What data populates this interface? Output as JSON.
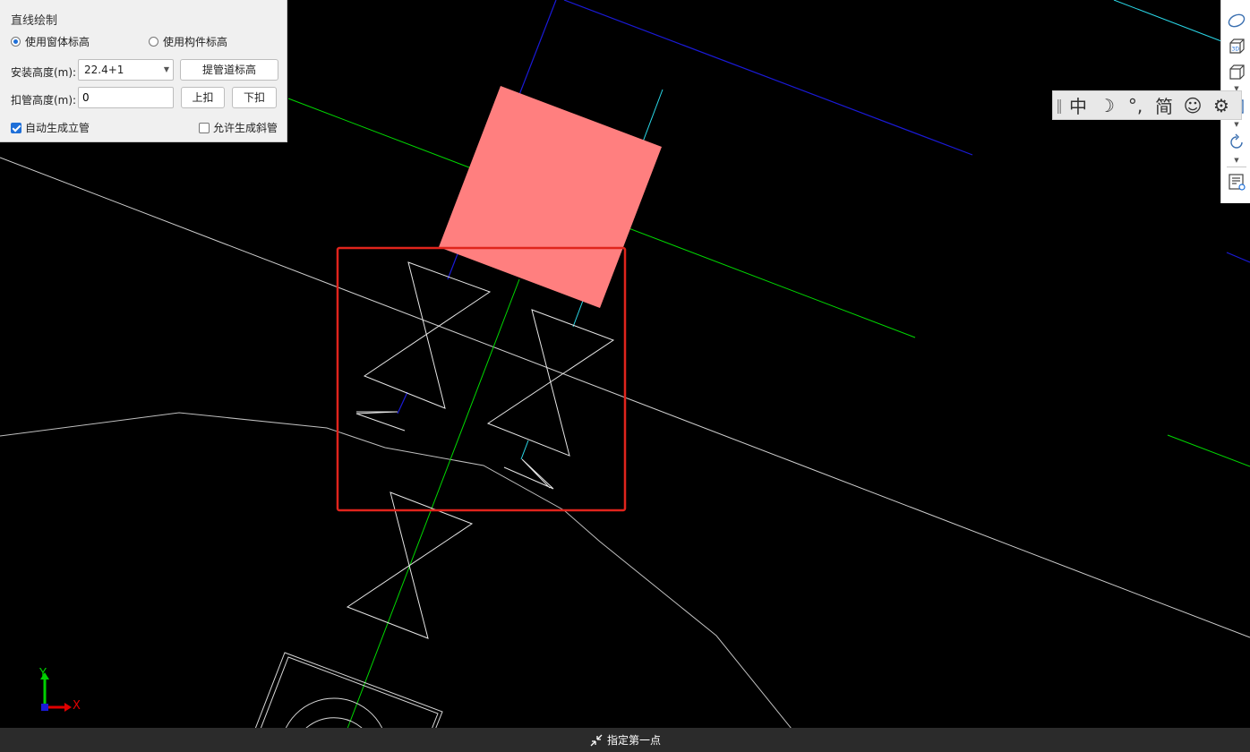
{
  "panel": {
    "title": "直线绘制",
    "radio_window": "使用窗体标高",
    "radio_component": "使用构件标高",
    "install_height_label": "安装高度(m):",
    "install_height_value": "22.4+1",
    "lift_pipe_button": "提管道标高",
    "buckle_height_label": "扣管高度(m):",
    "buckle_height_value": "0",
    "buckle_up_button": "上扣",
    "buckle_down_button": "下扣",
    "auto_riser_label": "自动生成立管",
    "auto_riser_checked": true,
    "allow_slant_label": "允许生成斜管",
    "allow_slant_checked": false
  },
  "ime": {
    "mode": "中",
    "night": "☽",
    "punct": "°,",
    "simplified": "简",
    "emoji": "☺",
    "settings": "⚙"
  },
  "status": {
    "prompt": "指定第一点"
  },
  "axis": {
    "x_label": "X",
    "y_label": "Y"
  },
  "colors": {
    "pipe_green": "#00d800",
    "pipe_blue": "#1a1ad8",
    "pipe_cyan": "#2ad8e8",
    "selection": "#e0241c",
    "component_fill": "#ff7f7f"
  }
}
